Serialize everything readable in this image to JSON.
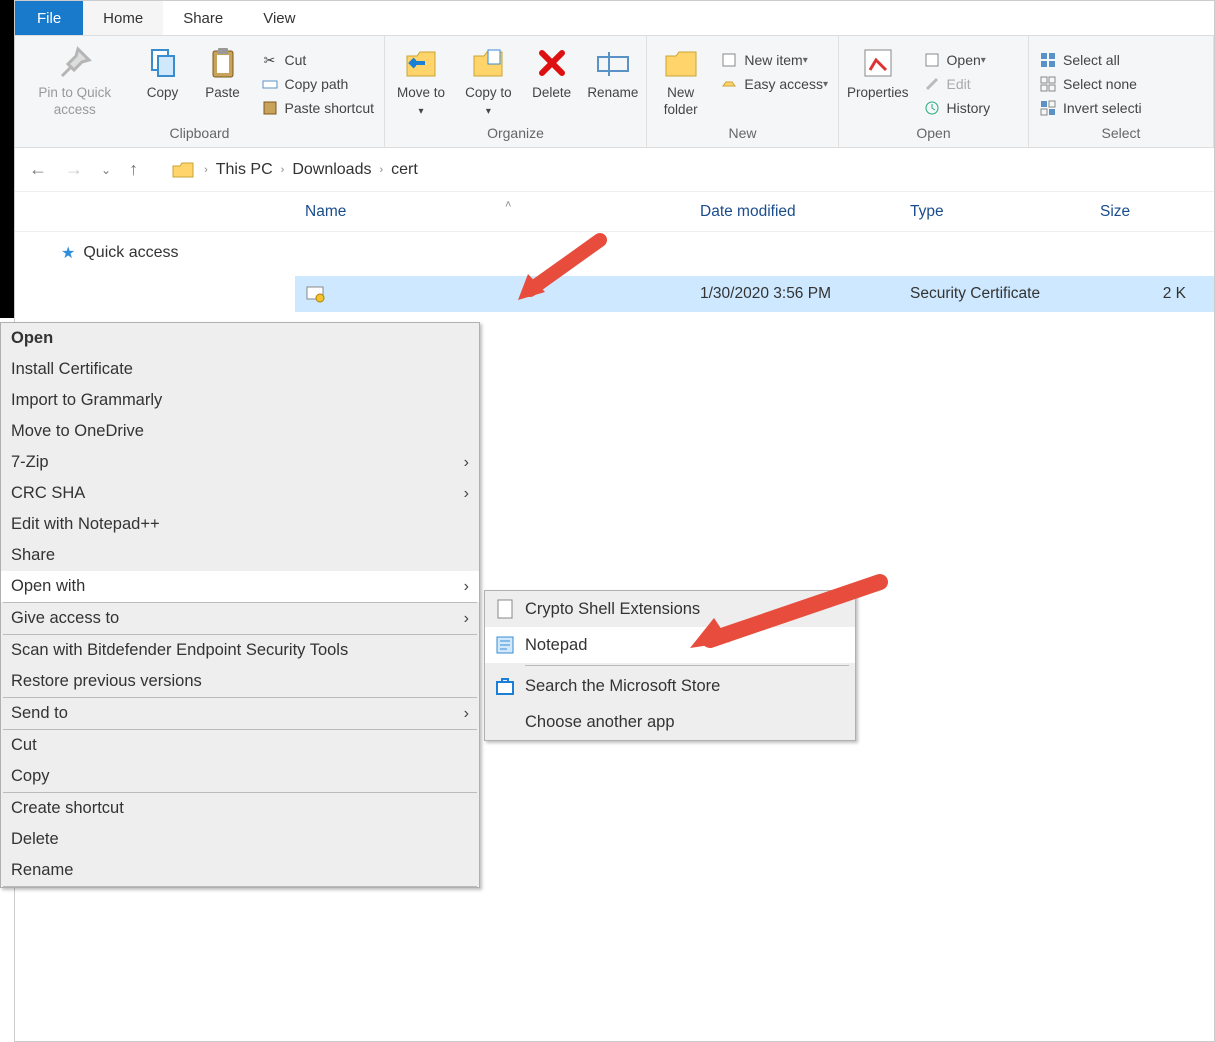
{
  "tabs": {
    "file": "File",
    "home": "Home",
    "share": "Share",
    "view": "View"
  },
  "ribbon": {
    "clipboard": {
      "label": "Clipboard",
      "pin": "Pin to Quick access",
      "copy": "Copy",
      "paste": "Paste",
      "cut": "Cut",
      "copypath": "Copy path",
      "pasteshortcut": "Paste shortcut"
    },
    "organize": {
      "label": "Organize",
      "moveto": "Move to",
      "copyto": "Copy to",
      "delete": "Delete",
      "rename": "Rename"
    },
    "new": {
      "label": "New",
      "newfolder": "New folder",
      "newitem": "New item",
      "easyaccess": "Easy access"
    },
    "open": {
      "label": "Open",
      "properties": "Properties",
      "open": "Open",
      "edit": "Edit",
      "history": "History"
    },
    "select": {
      "label": "Select",
      "selectall": "Select all",
      "selectnone": "Select none",
      "invert": "Invert selecti"
    }
  },
  "breadcrumb": [
    "This PC",
    "Downloads",
    "cert"
  ],
  "columns": {
    "name": "Name",
    "date": "Date modified",
    "type": "Type",
    "size": "Size"
  },
  "sidebar": {
    "quickaccess": "Quick access"
  },
  "file": {
    "date": "1/30/2020 3:56 PM",
    "type": "Security Certificate",
    "size": "2 K"
  },
  "context": {
    "open": "Open",
    "install": "Install Certificate",
    "grammarly": "Import to Grammarly",
    "onedrive": "Move to OneDrive",
    "sevenzip": "7-Zip",
    "crcsha": "CRC SHA",
    "notepadpp": "Edit with Notepad++",
    "share": "Share",
    "openwith": "Open with",
    "giveaccess": "Give access to",
    "bitdefender": "Scan with Bitdefender Endpoint Security Tools",
    "restore": "Restore previous versions",
    "sendto": "Send to",
    "cut": "Cut",
    "copy": "Copy",
    "createshortcut": "Create shortcut",
    "delete": "Delete",
    "rename": "Rename"
  },
  "submenu": {
    "crypto": "Crypto Shell Extensions",
    "notepad": "Notepad",
    "msstore": "Search the Microsoft Store",
    "chooseapp": "Choose another app"
  }
}
